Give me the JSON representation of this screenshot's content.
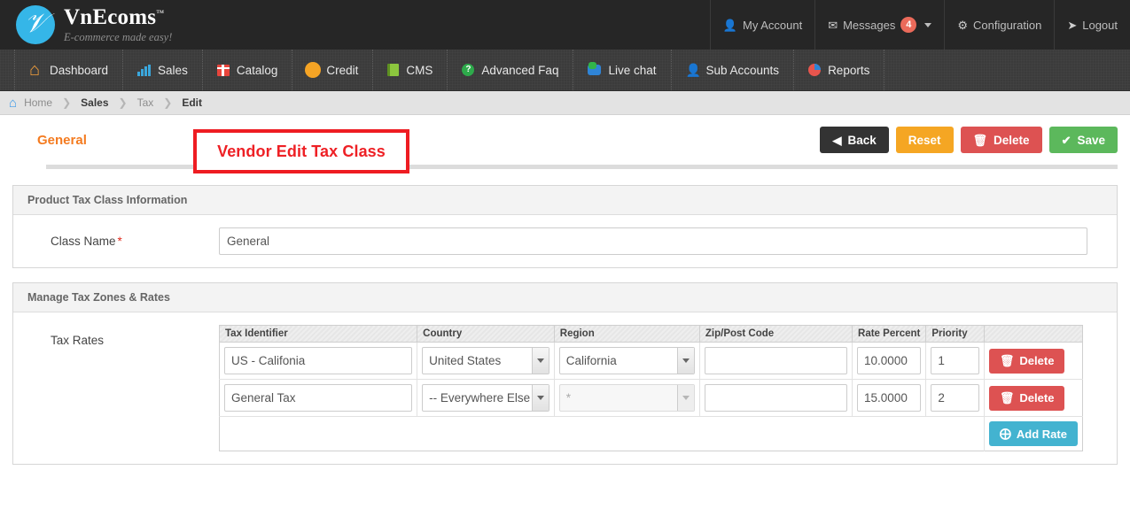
{
  "header": {
    "brand_name": "VnEcoms",
    "brand_tm": "™",
    "brand_tagline": "E-commerce made easy!",
    "account_label": "My Account",
    "messages_label": "Messages",
    "messages_count": "4",
    "configuration_label": "Configuration",
    "logout_label": "Logout"
  },
  "nav": {
    "items": [
      {
        "label": "Dashboard",
        "icon": "home-icon"
      },
      {
        "label": "Sales",
        "icon": "bar-chart-icon"
      },
      {
        "label": "Catalog",
        "icon": "gift-icon"
      },
      {
        "label": "Credit",
        "icon": "sun-icon"
      },
      {
        "label": "CMS",
        "icon": "book-icon"
      },
      {
        "label": "Advanced Faq",
        "icon": "question-icon"
      },
      {
        "label": "Live chat",
        "icon": "chat-icon"
      },
      {
        "label": "Sub Accounts",
        "icon": "person-icon"
      },
      {
        "label": "Reports",
        "icon": "pie-chart-icon"
      }
    ]
  },
  "breadcrumb": {
    "home": "Home",
    "items": [
      "Sales",
      "Tax",
      "Edit"
    ],
    "separator": "❯"
  },
  "page": {
    "tab_general": "General",
    "annotation": "Vendor Edit Tax Class",
    "buttons": {
      "back": "Back",
      "reset": "Reset",
      "delete": "Delete",
      "save": "Save"
    }
  },
  "class_panel": {
    "title": "Product Tax Class Information",
    "class_name_label": "Class Name",
    "required_marker": "*",
    "class_name_value": "General",
    "class_name_placeholder": ""
  },
  "rates_panel": {
    "title": "Manage Tax Zones & Rates",
    "tax_rates_label": "Tax Rates",
    "columns": [
      "Tax Identifier",
      "Country",
      "Region",
      "Zip/Post Code",
      "Rate Percent",
      "Priority",
      ""
    ],
    "rows": [
      {
        "identifier": "US - Califonia",
        "country": "United States",
        "region": "California",
        "region_disabled": false,
        "zip": "",
        "rate": "10.0000",
        "priority": "1",
        "delete_label": "Delete"
      },
      {
        "identifier": "General Tax",
        "country": "-- Everywhere Else",
        "region": "*",
        "region_disabled": true,
        "zip": "",
        "rate": "15.0000",
        "priority": "2",
        "delete_label": "Delete"
      }
    ],
    "add_rate_label": "Add Rate"
  },
  "colors": {
    "brand_blue": "#35b6e8",
    "accent_orange": "#f47b20",
    "danger_red": "#dd5252",
    "success_green": "#5cb85c",
    "warning_orange": "#f5a623",
    "info_blue": "#43b3d0",
    "annotation_red": "#ee1c22",
    "badge_red": "#eb6a5a"
  }
}
